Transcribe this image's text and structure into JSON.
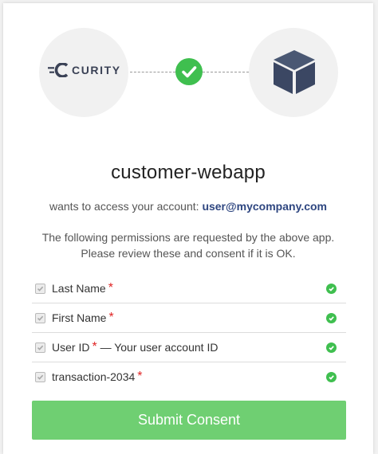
{
  "brand": {
    "name": "CURITY",
    "accent_color": "#3b4256",
    "success_color": "#3fbf4f"
  },
  "app": {
    "name": "customer-webapp",
    "icon": "cube-icon"
  },
  "access": {
    "prefix": "wants to access your account:",
    "user": "user@mycompany.com"
  },
  "permissions_text": {
    "line1": "The following permissions are requested by the above app.",
    "line2": "Please review these and consent if it is OK."
  },
  "permissions": [
    {
      "label": "Last Name",
      "required": "*",
      "description": "",
      "checked": true
    },
    {
      "label": "First Name",
      "required": "*",
      "description": "",
      "checked": true
    },
    {
      "label": "User ID",
      "required": "*",
      "description": " — Your user account ID",
      "checked": true
    },
    {
      "label": "transaction-2034",
      "required": "*",
      "description": "",
      "checked": true
    }
  ],
  "submit": {
    "label": "Submit Consent",
    "color": "#6fcf72"
  }
}
